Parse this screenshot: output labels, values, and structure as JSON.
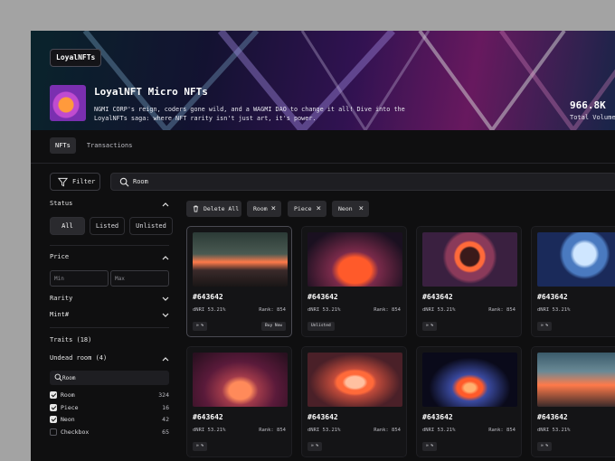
{
  "brand": "LoyalNFTs",
  "collection": {
    "title": "LoyalNFT Micro NFTs",
    "description": "NGMI CORP's reign, coders gone wild, and a WAGMI DAO to change it all! Dive into the LoyalNFTs saga: where NFT rarity isn't just art, it's power.",
    "volume_value": "966.8K",
    "volume_label": "Total Volume"
  },
  "tabs": [
    "NFTs",
    "Transactions"
  ],
  "toolbar": {
    "filter_label": "Filter",
    "search_value": "Room"
  },
  "sidebar": {
    "status_label": "Status",
    "status_options": [
      "All",
      "Listed",
      "Unlisted"
    ],
    "price_label": "Price",
    "price_min_placeholder": "Min",
    "price_max_placeholder": "Max",
    "rarity_label": "Rarity",
    "mint_label": "Mint#",
    "traits_label": "Traits (18)",
    "group_label": "Undead room (4)",
    "trait_search_value": "Room",
    "traits": [
      {
        "name": "Room",
        "count": "324",
        "checked": true
      },
      {
        "name": "Piece",
        "count": "16",
        "checked": true
      },
      {
        "name": "Neon",
        "count": "42",
        "checked": true
      },
      {
        "name": "Checkbox",
        "count": "65",
        "checked": false
      }
    ]
  },
  "chips": {
    "delete_all": "Delete All",
    "filters": [
      "Room",
      "Piece",
      "Neon"
    ]
  },
  "cards": [
    {
      "id": "#643642",
      "dnri": "dNRI 53.21%",
      "rank": "Rank: 854",
      "tag": "∞ %",
      "action": "Buy Now"
    },
    {
      "id": "#643642",
      "dnri": "dNRI 53.21%",
      "rank": "Rank: 854",
      "tag": "Unlisted",
      "action": ""
    },
    {
      "id": "#643642",
      "dnri": "dNRI 53.21%",
      "rank": "Rank: 854",
      "tag": "∞ %",
      "action": ""
    },
    {
      "id": "#643642",
      "dnri": "dNRI 53.21%",
      "rank": "",
      "tag": "∞ %",
      "action": ""
    },
    {
      "id": "#643642",
      "dnri": "dNRI 53.21%",
      "rank": "Rank: 854",
      "tag": "∞ %",
      "action": ""
    },
    {
      "id": "#643642",
      "dnri": "dNRI 53.21%",
      "rank": "Rank: 854",
      "tag": "∞ %",
      "action": ""
    },
    {
      "id": "#643642",
      "dnri": "dNRI 53.21%",
      "rank": "Rank: 854",
      "tag": "∞ %",
      "action": ""
    },
    {
      "id": "#643642",
      "dnri": "dNRI 53.21%",
      "rank": "",
      "tag": "∞ %",
      "action": ""
    }
  ],
  "colors": {
    "background": "#0f0f10",
    "card": "#141416",
    "accent_neon": "#ff5a2a",
    "hero_purple": "#7a1e70"
  }
}
